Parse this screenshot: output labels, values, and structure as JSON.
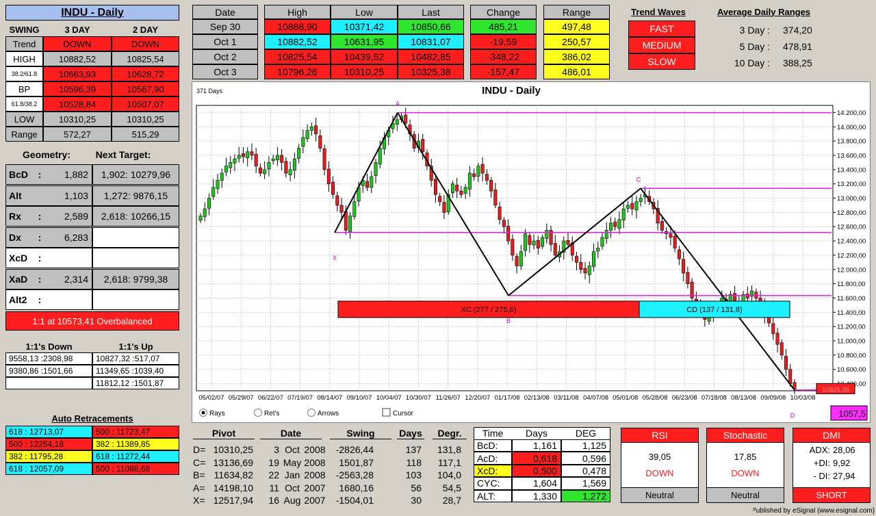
{
  "left": {
    "title": "INDU - Daily",
    "swing_label": "SWING",
    "col3": "3 DAY",
    "col2": "2 DAY",
    "rows": [
      {
        "label": "Trend",
        "v3": "DOWN",
        "v2": "DOWN"
      },
      {
        "label": "HIGH",
        "v3": "10882,52",
        "v2": "10825,54"
      },
      {
        "label": "38.2/61.8",
        "v3": "10663,93",
        "v2": "10628,72"
      },
      {
        "label": "BP",
        "v3": "10596,39",
        "v2": "10567,90"
      },
      {
        "label": "61.8/38.2",
        "v3": "10528,84",
        "v2": "10507,07"
      },
      {
        "label": "LOW",
        "v3": "10310,25",
        "v2": "10310,25"
      },
      {
        "label": "Range",
        "v3": "572,27",
        "v2": "515,29"
      }
    ],
    "geometry_label": "Geometry:",
    "next_target_label": "Next Target:",
    "geometry": [
      {
        "label": "BcD",
        "sep": ":",
        "value": "1,882",
        "target": "1,902: 10279,96"
      },
      {
        "label": "Alt",
        "sep": "",
        "value": "1,103",
        "target": "1,272: 9876,15"
      },
      {
        "label": "Rx",
        "sep": ":",
        "value": "2,589",
        "target": "2,618: 10266,15"
      },
      {
        "label": "Dx",
        "sep": ":",
        "value": "6,283",
        "target": ""
      },
      {
        "label": "XcD",
        "sep": ":",
        "value": "",
        "target": ""
      },
      {
        "label": "XaD",
        "sep": ":",
        "value": "2,314",
        "target": "2,618: 9799,38"
      },
      {
        "label": "Alt2",
        "sep": ":",
        "value": "",
        "target": ""
      }
    ],
    "overbalanced": "1:1 at 10573,41 Overbalanced",
    "one_down_label": "1:1's Down",
    "one_up_label": "1:1's Up",
    "ones": [
      {
        "down": "9558,13 :2308,98",
        "up": "10827,32 :517,07"
      },
      {
        "down": "9380,86 :1501,66",
        "up": "11349,65 :1039,40"
      },
      {
        "down": "",
        "up": "11812,12 :1501,87"
      }
    ],
    "auto_retr_label": "Auto Retracements",
    "retr": [
      {
        "a": "618 : 12713,07",
        "b": "500 : 11723,47"
      },
      {
        "a": "500 : 12254,18",
        "b": "382 : 11389,85"
      },
      {
        "a": "382 : 11795,28",
        "b": "618 : 11272,44"
      },
      {
        "a": "618 : 12057,09",
        "b": "500 : 11088,68"
      }
    ]
  },
  "top": {
    "date_label": "Date",
    "high_label": "High",
    "low_label": "Low",
    "last_label": "Last",
    "change_label": "Change",
    "range_label": "Range",
    "rows": [
      {
        "date": "Sep  30",
        "high": "10868,90",
        "low": "10371,42",
        "last": "10850,66",
        "change": "485,21",
        "range": "497,48"
      },
      {
        "date": "Oct  1",
        "high": "10882,52",
        "low": "10631,95",
        "last": "10831,07",
        "change": "-19,59",
        "range": "250,57"
      },
      {
        "date": "Oct  2",
        "high": "10825,54",
        "low": "10439,52",
        "last": "10482,85",
        "change": "-348,22",
        "range": "386,02"
      },
      {
        "date": "Oct  3",
        "high": "10796,26",
        "low": "10310,25",
        "last": "10325,38",
        "change": "-157,47",
        "range": "486,01"
      }
    ],
    "trend_waves_label": "Trend Waves",
    "waves": [
      "FAST",
      "MEDIUM",
      "SLOW"
    ],
    "adr_label": "Average Daily Ranges",
    "adr": [
      {
        "k": "3 Day :",
        "v": "374,20"
      },
      {
        "k": "5 Day :",
        "v": "478,91"
      },
      {
        "k": "10 Day :",
        "v": "388,25"
      }
    ]
  },
  "chart": {
    "days_label": "371 Days",
    "title": "INDU - Daily",
    "xc_label": "XC (277 / 275,6)",
    "cd_label": "CD (137 / 131,8)",
    "last_label": "10325,38",
    "value_box": "1057,5",
    "options": [
      {
        "label": "Rays",
        "checked": true
      },
      {
        "label": "Ret's",
        "checked": false
      },
      {
        "label": "Arrows",
        "checked": false
      }
    ],
    "cursor_label": "Cursor"
  },
  "chart_data": {
    "type": "candlestick",
    "title": "INDU - Daily",
    "x_tick_labels": [
      "05/02/07",
      "05/29/07",
      "06/22/07",
      "07/19/07",
      "08/14/07",
      "09/10/07",
      "10/04/07",
      "10/30/07",
      "11/26/07",
      "12/20/07",
      "01/17/08",
      "02/13/08",
      "03/11/08",
      "04/07/08",
      "05/01/08",
      "05/28/08",
      "06/23/08",
      "07/18/08",
      "08/13/08",
      "09/09/08",
      "10/03/08"
    ],
    "y_ticks": [
      10400,
      10600,
      10800,
      11000,
      11200,
      11400,
      11600,
      11800,
      12000,
      12200,
      12400,
      12600,
      12800,
      13000,
      13200,
      13400,
      13600,
      13800,
      14000,
      14200
    ],
    "ylim": [
      10300,
      14300
    ],
    "pattern": [
      {
        "label": "X",
        "date": "08/16/07",
        "price": 12517.94
      },
      {
        "label": "A",
        "date": "10/11/07",
        "price": 14198.1
      },
      {
        "label": "B",
        "date": "01/22/08",
        "price": 11634.82
      },
      {
        "label": "C",
        "date": "05/19/08",
        "price": 13136.69
      },
      {
        "label": "D",
        "date": "10/03/08",
        "price": 10310.25
      }
    ],
    "levels": [
      14198.1,
      13136.69,
      12517.94,
      11634.82,
      10310.25
    ],
    "closes": [
      12750,
      12850,
      13000,
      13150,
      13250,
      13350,
      13450,
      13500,
      13550,
      13600,
      13580,
      13650,
      13600,
      13450,
      13350,
      13400,
      13500,
      13550,
      13600,
      13500,
      13350,
      13400,
      13550,
      13700,
      13850,
      13950,
      14000,
      13900,
      13700,
      13400,
      13200,
      13050,
      12900,
      12800,
      12550,
      12750,
      12950,
      13150,
      13250,
      13150,
      13300,
      13500,
      13700,
      13850,
      13950,
      14050,
      14100,
      14150,
      14050,
      13900,
      13700,
      13800,
      13650,
      13450,
      13250,
      13050,
      12950,
      12800,
      13050,
      13200,
      13100,
      13050,
      13150,
      13350,
      13300,
      13450,
      13350,
      13250,
      13100,
      12900,
      12700,
      12600,
      12400,
      12200,
      12050,
      12250,
      12500,
      12350,
      12400,
      12300,
      12450,
      12550,
      12350,
      12200,
      12250,
      12400,
      12350,
      12200,
      12100,
      12000,
      11950,
      12050,
      12250,
      12300,
      12450,
      12550,
      12650,
      12600,
      12700,
      12850,
      12900,
      12850,
      12950,
      13000,
      13050,
      12950,
      12850,
      12650,
      12550,
      12500,
      12450,
      12300,
      12150,
      11950,
      11800,
      11600,
      11500,
      11400,
      11300,
      11350,
      11450,
      11500,
      11600,
      11550,
      11650,
      11500,
      11550,
      11650,
      11600,
      11700,
      11600,
      11500,
      11350,
      11250,
      11100,
      10950,
      10800,
      10600,
      10400,
      10325
    ],
    "indicators": {
      "rsi": {
        "value": "39,05",
        "state": "DOWN",
        "signal": "Neutral"
      },
      "stochastic": {
        "value": "17,85",
        "state": "DOWN",
        "signal": "Neutral"
      },
      "dmi": {
        "adx": "28,06",
        "plus_di": "9,92",
        "minus_di": "27,94",
        "signal": "SHORT"
      }
    }
  },
  "pivots": {
    "h_pivot": "Pivot",
    "h_date": "Date",
    "h_swing": "Swing",
    "h_days": "Days",
    "h_degr": "Degr.",
    "rows": [
      {
        "k": "D=",
        "p": "10310,25",
        "d": "3",
        "m": "Oct",
        "y": "2008",
        "s": "-2826,44",
        "days": "137",
        "deg": "131,8"
      },
      {
        "k": "C=",
        "p": "13136,69",
        "d": "19",
        "m": "May",
        "y": "2008",
        "s": "1501,87",
        "days": "118",
        "deg": "117,1"
      },
      {
        "k": "B=",
        "p": "11634,82",
        "d": "22",
        "m": "Jan",
        "y": "2008",
        "s": "-2563,28",
        "days": "103",
        "deg": "104,0"
      },
      {
        "k": "A=",
        "p": "14198,10",
        "d": "11",
        "m": "Oct",
        "y": "2007",
        "s": "1680,16",
        "days": "56",
        "deg": "54,5"
      },
      {
        "k": "X=",
        "p": "12517,94",
        "d": "16",
        "m": "Aug",
        "y": "2007",
        "s": "-1504,01",
        "days": "30",
        "deg": "28,7"
      }
    ]
  },
  "time": {
    "h_time": "Time",
    "h_days": "Days",
    "h_deg": "DEG",
    "rows": [
      {
        "k": "BcD:",
        "days": "1,161",
        "deg": "1,125"
      },
      {
        "k": "AcD:",
        "days": "0,618",
        "deg": "0,596"
      },
      {
        "k": "XcD:",
        "days": "0,500",
        "deg": "0,478"
      },
      {
        "k": "CYC:",
        "days": "1,604",
        "deg": "1,569"
      },
      {
        "k": "ALT:",
        "days": "1,330",
        "deg": "1,272"
      }
    ]
  },
  "ind_labels": {
    "rsi": "RSI",
    "stochastic": "Stochastic",
    "dmi": "DMI",
    "adx": "ADX:",
    "plus": "+DI:",
    "minus": "- DI:"
  },
  "footer": "Published by eSignal (www.esignal.com)"
}
